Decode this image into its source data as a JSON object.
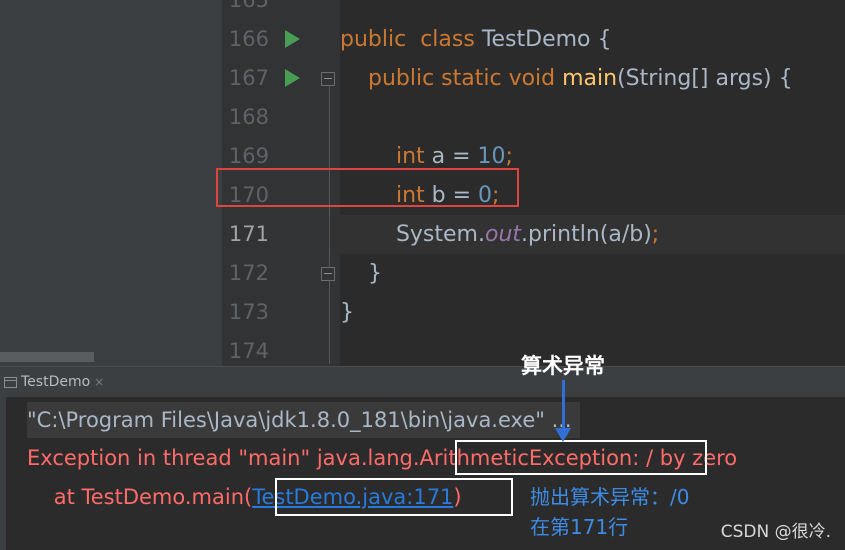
{
  "editor": {
    "lines": [
      {
        "number": "165",
        "tokens": [],
        "run_icon": false,
        "fold_icon": false,
        "current": false
      },
      {
        "number": "166",
        "tokens": [
          {
            "t": "public",
            "c": "kw"
          },
          {
            "t": "  "
          },
          {
            "t": "class",
            "c": "kw"
          },
          {
            "t": " TestDemo {"
          }
        ],
        "run_icon": true,
        "fold_icon": false,
        "current": false
      },
      {
        "number": "167",
        "tokens": [
          {
            "t": "    "
          },
          {
            "t": "public static void",
            "c": "kw"
          },
          {
            "t": " "
          },
          {
            "t": "main",
            "c": "fn"
          },
          {
            "t": "(String[] args) {"
          }
        ],
        "run_icon": true,
        "fold_icon": true,
        "current": false
      },
      {
        "number": "168",
        "tokens": [],
        "run_icon": false,
        "fold_icon": false,
        "current": false
      },
      {
        "number": "169",
        "tokens": [
          {
            "t": "        "
          },
          {
            "t": "int",
            "c": "kw"
          },
          {
            "t": " a = "
          },
          {
            "t": "10",
            "c": "num"
          },
          {
            "t": ";",
            "c": "kw"
          }
        ],
        "run_icon": false,
        "fold_icon": false,
        "current": false
      },
      {
        "number": "170",
        "tokens": [
          {
            "t": "        "
          },
          {
            "t": "int",
            "c": "kw"
          },
          {
            "t": " b = "
          },
          {
            "t": "0",
            "c": "num"
          },
          {
            "t": ";",
            "c": "kw"
          }
        ],
        "run_icon": false,
        "fold_icon": false,
        "current": false
      },
      {
        "number": "171",
        "tokens": [
          {
            "t": "        System."
          },
          {
            "t": "out",
            "c": "fld"
          },
          {
            "t": ".println(a/b)"
          },
          {
            "t": ";",
            "c": "kw"
          }
        ],
        "run_icon": false,
        "fold_icon": false,
        "current": true
      },
      {
        "number": "172",
        "tokens": [
          {
            "t": "    }"
          }
        ],
        "run_icon": false,
        "fold_icon": true,
        "current": false
      },
      {
        "number": "173",
        "tokens": [
          {
            "t": "}"
          }
        ],
        "run_icon": false,
        "fold_icon": false,
        "current": false
      },
      {
        "number": "174",
        "tokens": [],
        "run_icon": false,
        "fold_icon": false,
        "current": false
      }
    ]
  },
  "run_window": {
    "tab_label": "TestDemo",
    "tab_close": "×",
    "command_line": "\"C:\\Program Files\\Java\\jdk1.8.0_181\\bin\\java.exe\" ...",
    "exception": {
      "prefix": "Exception in thread \"main\" java.lang.",
      "type": "ArithmeticException:",
      "message": " / by zero"
    },
    "stack": {
      "prefix": "    at TestDemo.main(",
      "link": "TestDemo.java:171",
      "suffix": ")"
    }
  },
  "annotations": {
    "title": "算术异常",
    "note_line1": "抛出算术异常：/0",
    "note_line2": "在第171行"
  },
  "watermark": "CSDN @很冷."
}
